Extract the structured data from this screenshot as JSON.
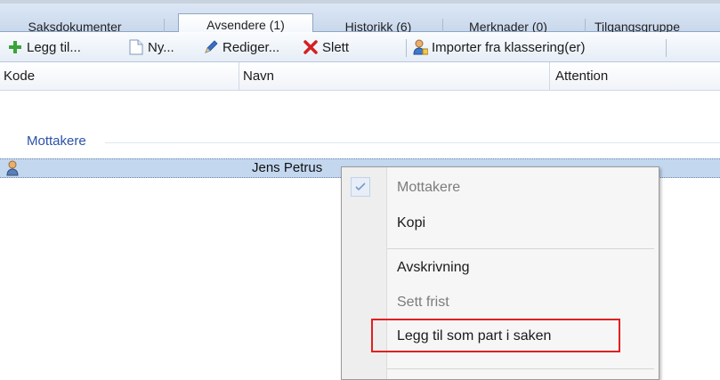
{
  "tabs": [
    {
      "label": "Saksdokumenter"
    },
    {
      "label": "Avsendere (1)"
    },
    {
      "label": "Historikk (6)"
    },
    {
      "label": "Merknader (0)"
    },
    {
      "label": "Tilgangsgruppe"
    }
  ],
  "toolbar": {
    "add_label": "Legg til...",
    "new_label": "Ny...",
    "edit_label": "Rediger...",
    "delete_label": "Slett",
    "import_label": "Importer fra klassering(er)"
  },
  "columns": {
    "kode": "Kode",
    "navn": "Navn",
    "attention": "Attention"
  },
  "group": {
    "label": "Mottakere"
  },
  "row": {
    "name": "Jens Petrus"
  },
  "menu": {
    "items": [
      {
        "label": "Mottakere"
      },
      {
        "label": "Kopi"
      },
      {
        "label": "Avskrivning"
      },
      {
        "label": "Sett frist"
      },
      {
        "label": "Legg til som part i saken"
      }
    ]
  },
  "colors": {
    "highlight": "#e02020",
    "accent": "#2a52a8"
  }
}
